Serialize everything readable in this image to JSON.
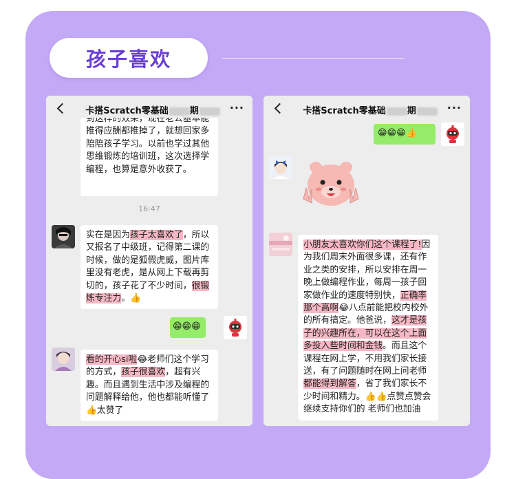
{
  "section_title": "孩子喜欢",
  "left_chat": {
    "title": "卡搭Scratch零基础",
    "title_suffix": "期",
    "msg1_text": "到这样的效果，现在老公基本能推得应酬都推掉了，就想回家多陪陪孩子学习。以前也学过其他思维锻炼的培训班，这次选择学编程，也算是意外收获了。",
    "timestamp": "16:47",
    "msg2": {
      "part1": "实在是因为",
      "hl1": "孩子太喜欢了",
      "part2": "，所以又报名了中级班，记得第二课的时候，做的是狐假虎威，图片库里没有老虎，是从网上下载再剪切的，孩子花了不少时间，",
      "hl2": "很锻炼专注力",
      "part3": "。👍"
    },
    "reply_emojis": "😁😁😁",
    "msg3": {
      "hl1": "看的开心si啦",
      "part1": "😂老师们这个学习的方式，",
      "hl2": "孩子很喜欢",
      "part2": "，超有兴趣。而且遇到生活中涉及编程的问题解释给他，他也都能听懂了👍太赞了"
    }
  },
  "right_chat": {
    "title": "卡搭Scratch零基础",
    "title_suffix": "期",
    "sent_emojis": "😁😁😁👍",
    "msg": {
      "hl1": "小朋友太喜欢你们这个课程了!",
      "part1": "因为我们周末外面很多课，还有作业之类的安排，所以安排在周一晚上做编程作业，每周一孩子回家做作业的速度特别快，",
      "hl2": "正确率那个高啊",
      "part2": "😂八点前能把校内校外的所有搞定。他爸说，",
      "hl3": "这才是孩子的兴趣所在，可以在这个上面多投入些时间和金钱",
      "part3": "。而且这个课程在网上学，不用我们家长接送，有了问题随时在网上问老师",
      "hl4": "都能得到解答",
      "part4": "，省了我们家长不少时间和精力。👍👍点赞点赞会继续支持你们的 老师们也加油"
    }
  },
  "colors": {
    "panel": "#c3a9f6",
    "title_text": "#6a3fd6",
    "bubble_green": "#95ec69",
    "highlight": "#f6b8c4",
    "chat_bg": "#ededed"
  },
  "icons": [
    "back-chevron-icon",
    "more-dots-icon",
    "robot-avatar-icon",
    "bear-sticker-icon"
  ]
}
